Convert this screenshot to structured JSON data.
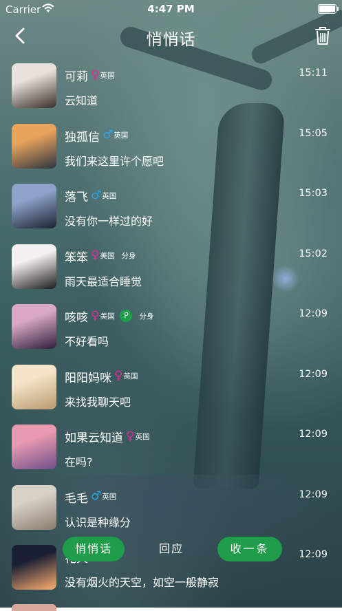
{
  "status_bar": {
    "carrier": "Carrier",
    "time": "4:47 PM"
  },
  "nav": {
    "title": "悄悄话",
    "back_icon": "chevron-left-icon",
    "trash_icon": "trash-icon"
  },
  "messages": [
    {
      "name": "可莉",
      "gender": "female",
      "country": "英国",
      "badge": "",
      "tag": "",
      "time": "15:11",
      "text": "云知道",
      "avatar_colors": [
        "#e9e2dc",
        "#3a2e2a"
      ]
    },
    {
      "name": "独孤信",
      "gender": "male",
      "country": "英国",
      "badge": "",
      "tag": "",
      "time": "15:05",
      "text": "我们来这里许个愿吧",
      "avatar_colors": [
        "#e9a45c",
        "#2d3340"
      ]
    },
    {
      "name": "落飞",
      "gender": "male",
      "country": "英国",
      "badge": "",
      "tag": "",
      "time": "15:03",
      "text": "没有你一样过的好",
      "avatar_colors": [
        "#8da3c9",
        "#1b2030"
      ]
    },
    {
      "name": "笨笨",
      "gender": "female",
      "country": "美国",
      "badge": "",
      "tag": "分身",
      "time": "15:02",
      "text": "雨天最适合睡觉",
      "avatar_colors": [
        "#f3f1ee",
        "#1b1b1b"
      ]
    },
    {
      "name": "咳咳",
      "gender": "female",
      "country": "美国",
      "badge": "P",
      "tag": "分身",
      "time": "12:09",
      "text": "不好看吗",
      "avatar_colors": [
        "#d9a8c4",
        "#2d1f3a"
      ]
    },
    {
      "name": "阳阳妈咪",
      "gender": "female",
      "country": "英国",
      "badge": "",
      "tag": "",
      "time": "12:09",
      "text": "来找我聊天吧",
      "avatar_colors": [
        "#f4e4c8",
        "#b99a70"
      ]
    },
    {
      "name": "如果云知道",
      "gender": "female",
      "country": "英国",
      "badge": "",
      "tag": "",
      "time": "12:09",
      "text": "在吗?",
      "avatar_colors": [
        "#e99ab0",
        "#6f4f8a"
      ]
    },
    {
      "name": "毛毛",
      "gender": "male",
      "country": "英国",
      "badge": "",
      "tag": "",
      "time": "12:09",
      "text": "认识是种缘分",
      "avatar_colors": [
        "#d8d1c8",
        "#8a7c6c"
      ]
    },
    {
      "name": "花火",
      "gender": "male",
      "country": "英国",
      "badge": "",
      "tag": "",
      "time": "12:09",
      "text": "没有烟火的天空，如空一般静寂",
      "avatar_colors": [
        "#1a1f33",
        "#ffb070"
      ]
    }
  ],
  "bottom": {
    "whisper": "悄悄话",
    "reply": "回应",
    "collect": "收一条"
  }
}
